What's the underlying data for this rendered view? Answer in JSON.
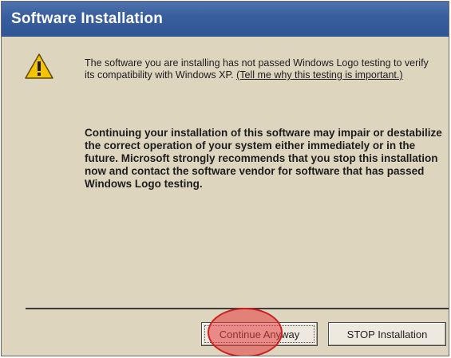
{
  "dialog": {
    "title": "Software Installation",
    "icon": "warning-icon",
    "message_intro": "The software you are installing has not passed Windows Logo testing to verify its compatibility with Windows XP.",
    "message_link": "(Tell me why this testing is important.)",
    "message_warning": "Continuing your installation of this software may impair or destabilize the correct operation of your system either immediately or in the future. Microsoft strongly recommends that you stop this installation now and contact the software vendor for software that has passed Windows Logo testing.",
    "buttons": {
      "continue_label": "Continue Anyway",
      "stop_label": "STOP Installation"
    }
  },
  "colors": {
    "title_bar": "#3a5f9f",
    "dialog_background": "#ded5bf",
    "highlight": "#e63c3c"
  }
}
